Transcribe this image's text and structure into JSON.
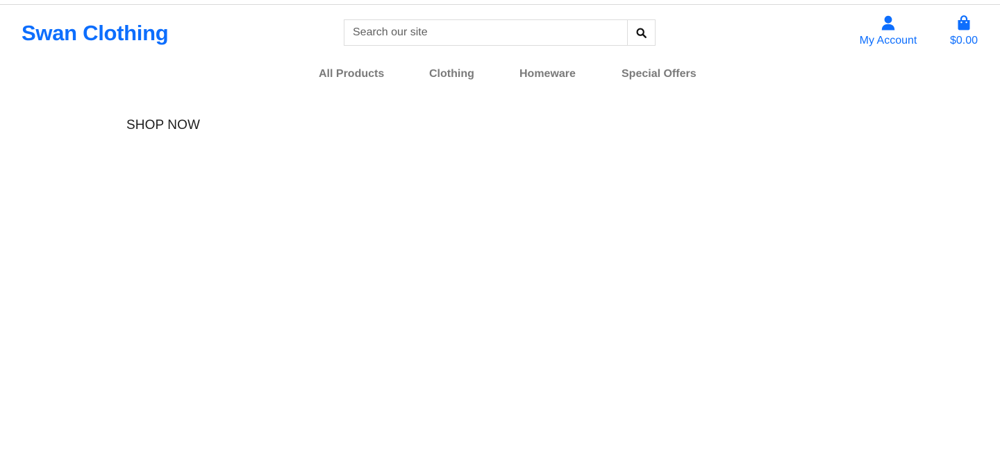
{
  "header": {
    "brand": {
      "part1": "Swan",
      "part2": "Clothing"
    },
    "search": {
      "placeholder": "Search our site",
      "value": "",
      "button_icon": "search-icon"
    },
    "account": {
      "icon": "user-icon",
      "label": "My Account"
    },
    "bag": {
      "icon": "shopping-bag-icon",
      "total": "$0.00"
    }
  },
  "nav": {
    "items": [
      {
        "label": "All Products"
      },
      {
        "label": "Clothing"
      },
      {
        "label": "Homeware"
      },
      {
        "label": "Special Offers"
      }
    ]
  },
  "main": {
    "cta_label": "SHOP NOW"
  },
  "colors": {
    "brand_blue": "#0d6efd",
    "nav_gray": "#7a7a7a",
    "text_dark": "#1e1e1e",
    "border": "#dcdcdc"
  }
}
